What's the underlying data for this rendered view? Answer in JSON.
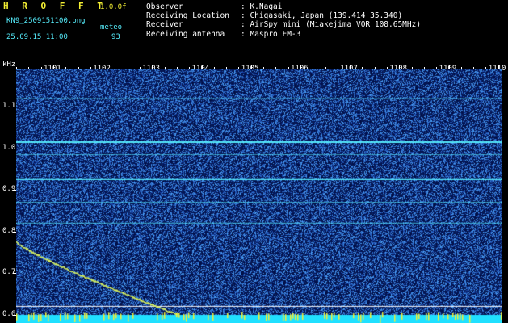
{
  "header": {
    "title": "H R O F F T",
    "version": "1.0.0f",
    "filename": "KN9_2509151100.png",
    "meteo_label": "meteo",
    "date": "25.09.15 11:00",
    "count": "93"
  },
  "meta": {
    "rows": [
      {
        "label": "Observer",
        "value": ": K.Nagai"
      },
      {
        "label": "Receiving Location",
        "value": ": Chigasaki, Japan (139.414 35.340)"
      },
      {
        "label": "Receiver",
        "value": ": AirSpy mini (Miakejima VOR 108.65MHz)"
      },
      {
        "label": "Receiving antenna",
        "value": ": Maspro FM-3"
      }
    ]
  },
  "spectrogram": {
    "y_unit": "kHz",
    "x_ticks": [
      "1101",
      "1102",
      "1103",
      "1104",
      "1105",
      "1106",
      "1107",
      "1108",
      "1109",
      "1110"
    ],
    "y_ticks": [
      "1.1",
      "1.0",
      "0.9",
      "0.8",
      "0.7",
      "0.6"
    ],
    "y_range": [
      0.58,
      1.19
    ],
    "background_color": "#020a36",
    "noise_color": "#3a70ff",
    "carrier_color": "#57f0ff",
    "trace_color": "#d8f05a",
    "carriers_khz": [
      1.12,
      1.015,
      0.985,
      0.925,
      0.87,
      0.82
    ],
    "meteor_trace": {
      "start_khz": 0.775,
      "end_khz": 0.6
    }
  }
}
